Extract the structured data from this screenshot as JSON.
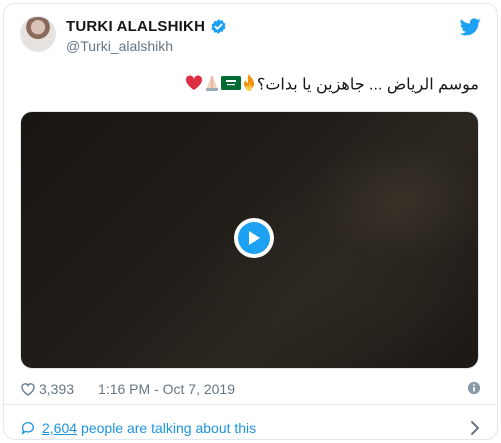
{
  "tweet": {
    "author_name": "TURKI ALALSHIKH",
    "author_handle": "@Turki_alalshikh",
    "text": "موسم الرياض ... جاهزين يا بدات؟",
    "emojis": [
      "fire",
      "saudi-flag",
      "praying-hands",
      "red-heart"
    ],
    "likes": "3,393",
    "timestamp": "1:16 PM - Oct 7, 2019",
    "talk_count": "2,604",
    "talk_text": "people are talking about this"
  },
  "colors": {
    "accent": "#1da1f2",
    "link": "#1b95e0",
    "muted": "#657786",
    "border": "#e1e8ed"
  }
}
